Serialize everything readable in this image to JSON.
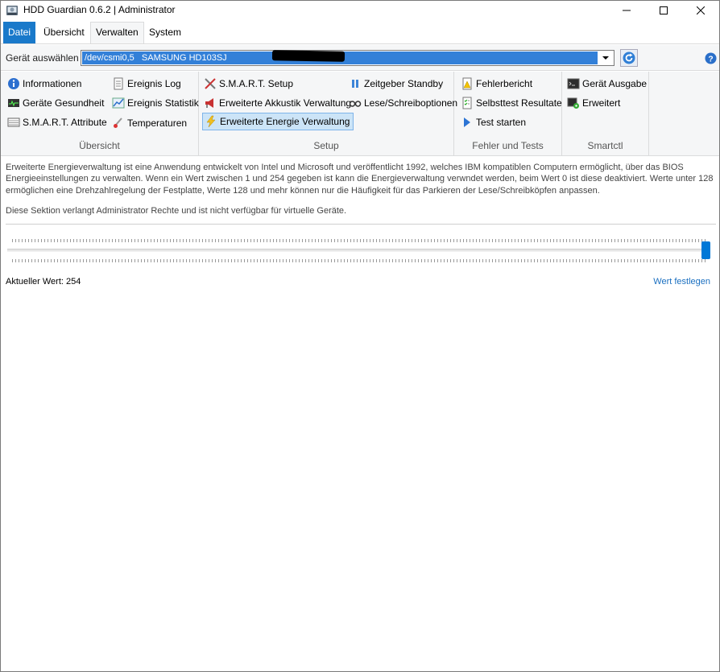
{
  "window": {
    "title": "HDD Guardian 0.6.2 | Administrator",
    "accent": "#1979ca"
  },
  "menu": {
    "items": [
      {
        "label": "Datei"
      },
      {
        "label": "Übersicht"
      },
      {
        "label": "Verwalten"
      },
      {
        "label": "System"
      }
    ],
    "active_index": 0,
    "selected_index": 2
  },
  "device": {
    "label": "Gerät auswählen",
    "selected_path": "/dev/csmi0,5",
    "selected_model": "SAMSUNG HD103SJ",
    "icons": {
      "refresh": "refresh-icon",
      "help": "help-icon",
      "dropdown": "chevron-down-icon"
    }
  },
  "ribbon": {
    "groups": [
      {
        "title": "Übersicht",
        "items": [
          {
            "label": "Informationen",
            "icon": "info-icon"
          },
          {
            "label": "Geräte Gesundheit",
            "icon": "health-monitor-icon"
          },
          {
            "label": "S.M.A.R.T. Attribute",
            "icon": "attribute-table-icon"
          },
          {
            "label": "Ereignis Log",
            "icon": "log-icon"
          },
          {
            "label": "Ereignis Statistik",
            "icon": "statistics-chart-icon"
          },
          {
            "label": "Temperaturen",
            "icon": "thermometer-icon"
          }
        ]
      },
      {
        "title": "Setup",
        "items": [
          {
            "label": "S.M.A.R.T. Setup",
            "icon": "tools-icon"
          },
          {
            "label": "Erweiterte Akkustik Verwaltung",
            "icon": "megaphone-icon"
          },
          {
            "label": "Erweiterte Energie Verwaltung",
            "icon": "lightning-icon"
          },
          {
            "label": "Zeitgeber Standby",
            "icon": "pause-icon"
          },
          {
            "label": "Lese/Schreiboptionen",
            "icon": "glasses-icon"
          }
        ]
      },
      {
        "title": "Fehler und Tests",
        "items": [
          {
            "label": "Fehlerbericht",
            "icon": "warning-document-icon"
          },
          {
            "label": "Selbsttest Resultate",
            "icon": "checklist-icon"
          },
          {
            "label": "Test starten",
            "icon": "play-icon"
          }
        ]
      },
      {
        "title": "Smartctl",
        "items": [
          {
            "label": "Gerät Ausgabe",
            "icon": "console-icon"
          },
          {
            "label": "Erweitert",
            "icon": "console-settings-icon"
          }
        ]
      }
    ]
  },
  "content": {
    "description": "Erweiterte Energieverwaltung ist eine Anwendung entwickelt von Intel und Microsoft und veröffentlicht 1992, welches IBM kompatiblen Computern ermöglicht, über das BIOS Energieeinstellungen zu verwalten. Wenn ein Wert zwischen 1 und 254 gegeben ist kann die Energieverwaltung verwndet werden, beim Wert 0 ist diese deaktiviert. Werte unter 128 ermöglichen eine Drehzahlregelung der Festplatte, Werte 128 und mehr können nur die Häufigkeit für das Parkieren der Lese/Schreibköpfen anpassen.",
    "admin_note": "Diese Sektion verlangt Administrator Rechte und ist nicht verfügbar für virtuelle Geräte.",
    "current_value_text": "Aktueller Wert: 254",
    "apply_link": "Wert festlegen",
    "slider": {
      "min": 0,
      "max": 254,
      "value": 254
    }
  }
}
